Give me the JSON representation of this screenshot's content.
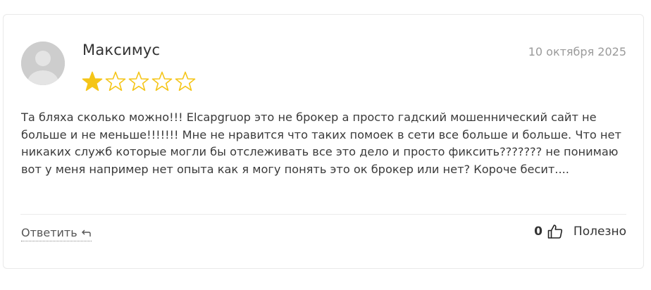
{
  "review": {
    "author": "Максимус",
    "date": "10 октября 2025",
    "rating": 1,
    "max_rating": 5,
    "star_color": "#f5c518",
    "text": "Та бляха сколько можно!!! Elcapgruop это не брокер а просто гадский мошеннический сайт не больше и не меньше!!!!!!! Мне не нравится что таких помоек в сети все больше и больше. Что нет никаких служб которые могли бы отслеживать все это дело и просто фиксить??????? не понимаю вот у меня например нет опыта как я могу понять это ок брокер или нет? Короче бесит...."
  },
  "actions": {
    "reply_label": "Ответить",
    "reply_icon": "reply-arrow-icon",
    "useful_count": "0",
    "useful_icon": "thumbs-up-icon",
    "useful_label": "Полезно"
  }
}
